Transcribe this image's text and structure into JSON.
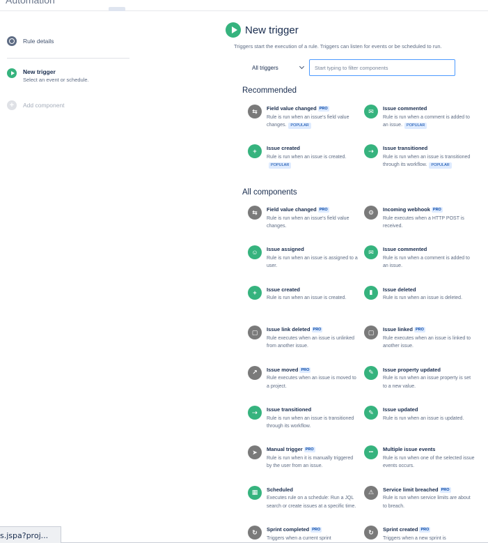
{
  "topbar": {
    "cut_title": "Automation"
  },
  "sidebar": {
    "rule_details": "Rule details",
    "new_trigger_title": "New trigger",
    "new_trigger_sub": "Select an event or schedule.",
    "add_component": "Add component"
  },
  "main": {
    "title": "New trigger",
    "description": "Triggers start the execution of a rule. Triggers can listen for events or be scheduled to run.",
    "filter_select": "All triggers",
    "search_placeholder": "Start typing to filter components",
    "recommended_title": "Recommended",
    "all_title": "All components",
    "pro_label": "PRO",
    "popular_label": "POPULAR"
  },
  "recommended": [
    {
      "title": "Field value changed",
      "desc": "Rule is run when an issue's field value changes.",
      "pro": true,
      "popular": true,
      "icon": "field-change-icon",
      "color": "gray"
    },
    {
      "title": "Issue commented",
      "desc": "Rule is run when a comment is added to an issue.",
      "pro": false,
      "popular": true,
      "icon": "comment-icon",
      "color": "green"
    },
    {
      "title": "Issue created",
      "desc": "Rule is run when an issue is created.",
      "pro": false,
      "popular": true,
      "icon": "plus-icon",
      "color": "green"
    },
    {
      "title": "Issue transitioned",
      "desc": "Rule is run when an issue is transitioned through its workflow.",
      "pro": false,
      "popular": true,
      "icon": "transition-icon",
      "color": "green"
    }
  ],
  "all": [
    {
      "title": "Field value changed",
      "desc": "Rule is run when an issue's field value changes.",
      "pro": true,
      "icon": "field-change-icon",
      "color": "gray"
    },
    {
      "title": "Incoming webhook",
      "desc": "Rule executes when a HTTP POST is received.",
      "pro": true,
      "icon": "webhook-icon",
      "color": "gray"
    },
    {
      "title": "Issue assigned",
      "desc": "Rule is run when an issue is assigned to a user.",
      "pro": false,
      "icon": "user-icon",
      "color": "green"
    },
    {
      "title": "Issue commented",
      "desc": "Rule is run when a comment is added to an issue.",
      "pro": false,
      "icon": "comment-icon",
      "color": "green"
    },
    {
      "title": "Issue created",
      "desc": "Rule is run when an issue is created.",
      "pro": false,
      "icon": "plus-icon",
      "color": "green"
    },
    {
      "title": "Issue deleted",
      "desc": "Rule is run when an issue is deleted.",
      "pro": false,
      "icon": "trash-icon",
      "color": "green"
    },
    {
      "title": "Issue link deleted",
      "desc": "Rule executes when an issue is unlinked from another issue.",
      "pro": true,
      "icon": "unlink-icon",
      "color": "gray"
    },
    {
      "title": "Issue linked",
      "desc": "Rule executes when an issue is linked to another issue.",
      "pro": true,
      "icon": "link-icon",
      "color": "gray"
    },
    {
      "title": "Issue moved",
      "desc": "Rule executes when an issue is moved to a project.",
      "pro": true,
      "icon": "move-icon",
      "color": "gray"
    },
    {
      "title": "Issue property updated",
      "desc": "Rule is run when an issue property is set to a new value.",
      "pro": false,
      "icon": "property-icon",
      "color": "green"
    },
    {
      "title": "Issue transitioned",
      "desc": "Rule is run when an issue is transitioned through its workflow.",
      "pro": false,
      "icon": "transition-icon",
      "color": "green"
    },
    {
      "title": "Issue updated",
      "desc": "Rule is run when an issue is updated.",
      "pro": false,
      "icon": "pencil-icon",
      "color": "green"
    },
    {
      "title": "Manual trigger",
      "desc": "Rule is run when it is manually triggered by the user from an issue.",
      "pro": true,
      "icon": "cursor-icon",
      "color": "gray"
    },
    {
      "title": "Multiple issue events",
      "desc": "Rule is run when one of the selected issue events occurs.",
      "pro": false,
      "icon": "more-icon",
      "color": "green"
    },
    {
      "title": "Scheduled",
      "desc": "Executes rule on a schedule: Run a JQL search or create issues at a specific time.",
      "pro": false,
      "icon": "calendar-icon",
      "color": "green"
    },
    {
      "title": "Service limit breached",
      "desc": "Rule is run when service limits are about to breach.",
      "pro": true,
      "icon": "alert-icon",
      "color": "gray"
    },
    {
      "title": "Sprint completed",
      "desc": "Triggers when a current sprint",
      "pro": true,
      "icon": "sprint-icon",
      "color": "gray"
    },
    {
      "title": "Sprint created",
      "desc": "Triggers when a new sprint is",
      "pro": true,
      "icon": "sprint-icon",
      "color": "gray"
    }
  ],
  "statusbar": {
    "url": "s.jspa?proj..."
  }
}
